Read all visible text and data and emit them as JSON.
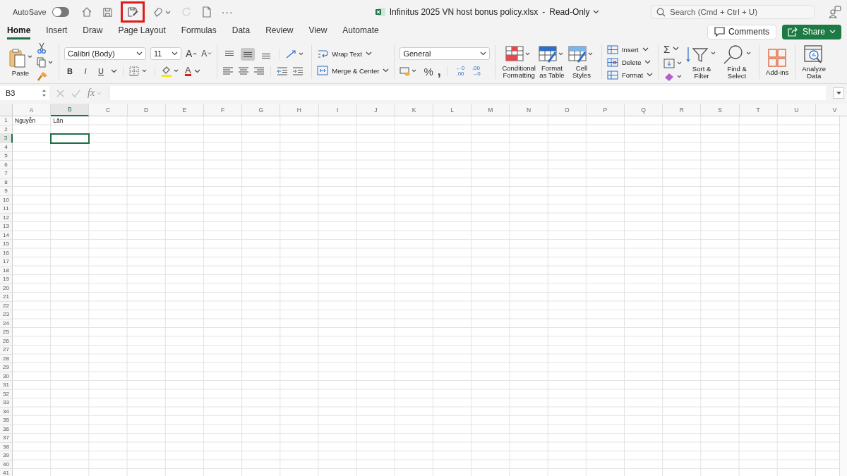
{
  "title_bar": {
    "autosave": {
      "label": "AutoSave",
      "on": false
    },
    "quick_access": [
      {
        "kind": "home",
        "highlighted": false,
        "disabled": false
      },
      {
        "kind": "save",
        "highlighted": false,
        "disabled": false
      },
      {
        "kind": "save-edit",
        "highlighted": true,
        "disabled": false
      },
      {
        "kind": "undo",
        "highlighted": false,
        "disabled": false
      },
      {
        "kind": "redo",
        "highlighted": false,
        "disabled": true
      },
      {
        "kind": "new",
        "highlighted": false,
        "disabled": false
      },
      {
        "kind": "more",
        "label": "···",
        "highlighted": false
      }
    ],
    "document_title": "Infinitus 2025 VN host bonus policy.xlsx",
    "separator": "-",
    "mode": "Read-Only",
    "search": {
      "placeholder": "Search (Cmd + Ctrl + U)"
    }
  },
  "tabs": [
    {
      "label": "Home",
      "selected": true
    },
    {
      "label": "Insert",
      "selected": false
    },
    {
      "label": "Draw",
      "selected": false
    },
    {
      "label": "Page Layout",
      "selected": false
    },
    {
      "label": "Formulas",
      "selected": false
    },
    {
      "label": "Data",
      "selected": false
    },
    {
      "label": "Review",
      "selected": false
    },
    {
      "label": "View",
      "selected": false
    },
    {
      "label": "Automate",
      "selected": false
    }
  ],
  "comments": "Comments",
  "share": "Share",
  "ribbon": {
    "paste": "Paste",
    "font_name": "Calibri (Body)",
    "font_size": "11",
    "grow_font": "A",
    "shrink_font": "A",
    "styles_buttons": [
      "B",
      "I",
      "U"
    ],
    "font_color": "A",
    "vertical_align": [
      {
        "selected": false
      },
      {
        "selected": true
      },
      {
        "selected": false
      }
    ],
    "wrap_text": "Wrap Text",
    "merge_center": "Merge & Center",
    "number_format": "General",
    "percent": "%",
    "comma": ",",
    "decimal_buttons": [
      {
        "top": "←0",
        "bottom": ".00"
      },
      {
        "top": ".00",
        "bottom": "→0"
      }
    ],
    "styles": [
      "Conditional\nFormatting",
      "Format\nas Table",
      "Cell\nStyles"
    ],
    "cells": [
      "Insert",
      "Delete",
      "Format"
    ],
    "autosum": "Σ",
    "editing": [
      "Sort &\nFilter",
      "Find &\nSelect"
    ],
    "add_ins": "Add-ins",
    "analyze": "Analyze\nData"
  },
  "formula_bar": {
    "name_box": "B3",
    "fx": "fx"
  },
  "sheet": {
    "columns": [
      {
        "label": "A",
        "selected": false
      },
      {
        "label": "B",
        "selected": true
      },
      {
        "label": "C",
        "selected": false
      },
      {
        "label": "D",
        "selected": false
      },
      {
        "label": "E",
        "selected": false
      },
      {
        "label": "F",
        "selected": false
      },
      {
        "label": "G",
        "selected": false
      },
      {
        "label": "H",
        "selected": false
      },
      {
        "label": "I",
        "selected": false
      },
      {
        "label": "J",
        "selected": false
      },
      {
        "label": "K",
        "selected": false
      },
      {
        "label": "L",
        "selected": false
      },
      {
        "label": "M",
        "selected": false
      },
      {
        "label": "N",
        "selected": false
      },
      {
        "label": "O",
        "selected": false
      },
      {
        "label": "P",
        "selected": false
      },
      {
        "label": "Q",
        "selected": false
      },
      {
        "label": "R",
        "selected": false
      },
      {
        "label": "S",
        "selected": false
      },
      {
        "label": "T",
        "selected": false
      },
      {
        "label": "U",
        "selected": false
      },
      {
        "label": "V",
        "selected": false
      }
    ],
    "rows": [
      {
        "label": "1",
        "selected": false,
        "cells": [
          "Nguyễn",
          "Lân"
        ]
      },
      {
        "label": "2",
        "selected": false
      },
      {
        "label": "3",
        "selected": true
      },
      {
        "label": "4",
        "selected": false
      },
      {
        "label": "5",
        "selected": false
      },
      {
        "label": "6",
        "selected": false
      },
      {
        "label": "7",
        "selected": false
      },
      {
        "label": "8",
        "selected": false
      },
      {
        "label": "9",
        "selected": false
      },
      {
        "label": "10",
        "selected": false
      },
      {
        "label": "11",
        "selected": false
      },
      {
        "label": "12",
        "selected": false
      },
      {
        "label": "13",
        "selected": false
      },
      {
        "label": "14",
        "selected": false
      },
      {
        "label": "15",
        "selected": false
      },
      {
        "label": "16",
        "selected": false
      },
      {
        "label": "17",
        "selected": false
      },
      {
        "label": "18",
        "selected": false
      },
      {
        "label": "19",
        "selected": false
      },
      {
        "label": "20",
        "selected": false
      },
      {
        "label": "21",
        "selected": false
      },
      {
        "label": "22",
        "selected": false
      },
      {
        "label": "23",
        "selected": false
      },
      {
        "label": "24",
        "selected": false
      },
      {
        "label": "25",
        "selected": false
      },
      {
        "label": "26",
        "selected": false
      },
      {
        "label": "27",
        "selected": false
      },
      {
        "label": "28",
        "selected": false
      },
      {
        "label": "29",
        "selected": false
      },
      {
        "label": "30",
        "selected": false
      },
      {
        "label": "31",
        "selected": false
      },
      {
        "label": "32",
        "selected": false
      },
      {
        "label": "33",
        "selected": false
      },
      {
        "label": "34",
        "selected": false
      },
      {
        "label": "35",
        "selected": false
      },
      {
        "label": "36",
        "selected": false
      },
      {
        "label": "37",
        "selected": false
      },
      {
        "label": "38",
        "selected": false
      },
      {
        "label": "39",
        "selected": false
      },
      {
        "label": "40",
        "selected": false
      },
      {
        "label": "41",
        "selected": false
      }
    ]
  }
}
